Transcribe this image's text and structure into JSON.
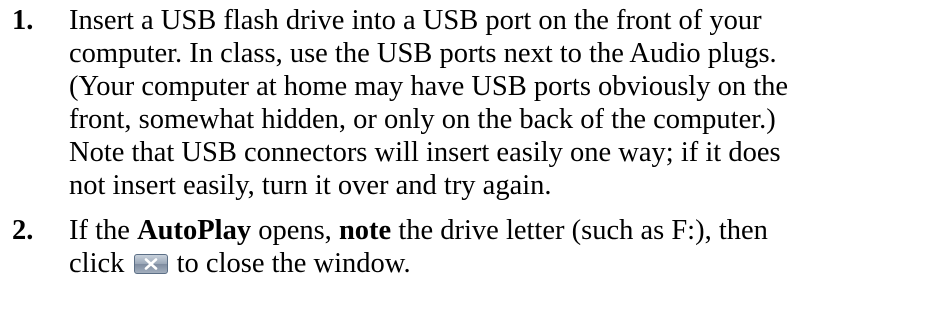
{
  "steps": [
    {
      "number": "1.",
      "lines": [
        "Insert a USB flash drive into a USB port on the front of your",
        "computer.  In class, use the USB ports next to the Audio plugs.",
        "(Your computer at home may have USB ports obviously on the",
        "front, somewhat hidden, or only on the back of the computer.)",
        "Note that USB connectors will insert easily one way; if it does",
        "not insert easily, turn it over and try again."
      ]
    },
    {
      "number": "2.",
      "line1": {
        "t1": "If the ",
        "b1": "AutoPlay",
        "t2": " opens, ",
        "b2": "note",
        "t3": " the drive letter (such as F:), then"
      },
      "line2": {
        "t1": "click ",
        "icon": "close-window-button-icon",
        "t2": " to close the window."
      }
    }
  ]
}
